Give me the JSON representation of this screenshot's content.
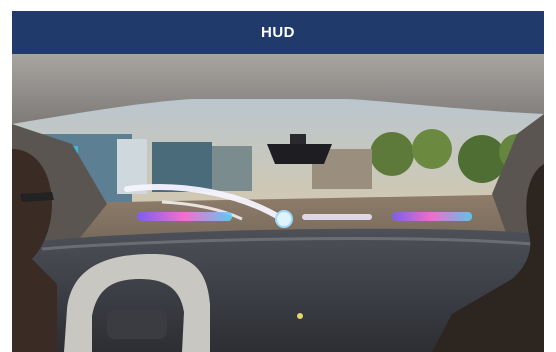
{
  "header": {
    "title": "HUD"
  },
  "scene": {
    "image_subject": "in-car-windshield-hud-photo"
  },
  "colors": {
    "title_bar": "#1f3a6b",
    "title_text": "#ffffff"
  }
}
